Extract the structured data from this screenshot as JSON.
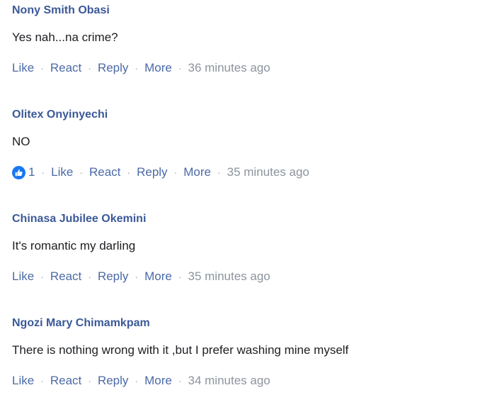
{
  "colors": {
    "author": "#3b5998",
    "action_link": "#4b6aa6",
    "timestamp": "#8d949e",
    "text": "#1c1e21",
    "like_badge": "#1877f2"
  },
  "separator": "·",
  "comments": [
    {
      "author": "Nony Smith Obasi",
      "text": "Yes nah...na  crime?",
      "actions": {
        "like": "Like",
        "react": "React",
        "reply": "Reply",
        "more": "More"
      },
      "time": "36 minutes ago"
    },
    {
      "author": "Olitex Onyinyechi",
      "text": "NO",
      "reaction": {
        "icon": "like-reaction-icon",
        "count": "1"
      },
      "actions": {
        "like": "Like",
        "react": "React",
        "reply": "Reply",
        "more": "More"
      },
      "time": "35 minutes ago"
    },
    {
      "author": "Chinasa Jubilee Okemini",
      "text": "It's romantic my darling",
      "actions": {
        "like": "Like",
        "react": "React",
        "reply": "Reply",
        "more": "More"
      },
      "time": "35 minutes ago"
    },
    {
      "author": "Ngozi Mary Chimamkpam",
      "text": "There is nothing wrong with it ,but I prefer washing mine myself",
      "actions": {
        "like": "Like",
        "react": "React",
        "reply": "Reply",
        "more": "More"
      },
      "time": "34 minutes ago"
    }
  ]
}
